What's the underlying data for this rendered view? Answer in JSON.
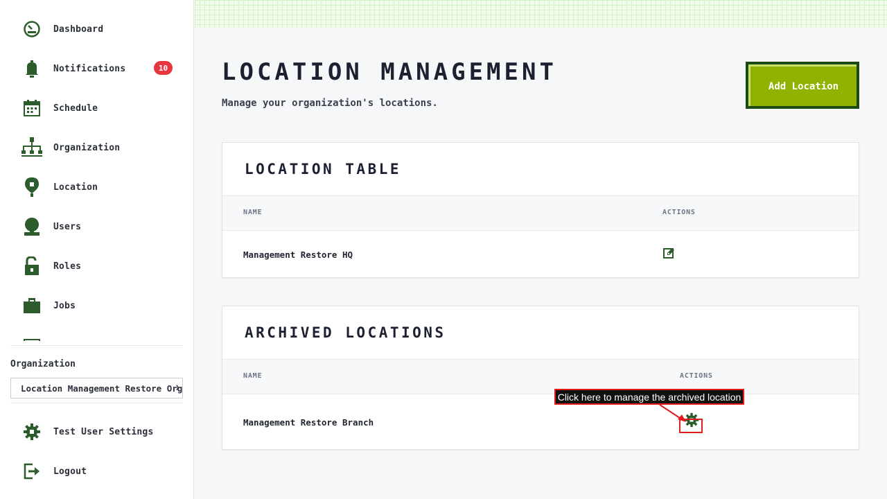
{
  "sidebar": {
    "items": [
      {
        "label": "Dashboard",
        "icon": "dashboard-icon"
      },
      {
        "label": "Notifications",
        "icon": "bell-icon",
        "badge": "10"
      },
      {
        "label": "Schedule",
        "icon": "calendar-icon"
      },
      {
        "label": "Organization",
        "icon": "org-chart-icon"
      },
      {
        "label": "Location",
        "icon": "map-pin-icon"
      },
      {
        "label": "Users",
        "icon": "user-icon"
      },
      {
        "label": "Roles",
        "icon": "lock-icon"
      },
      {
        "label": "Jobs",
        "icon": "briefcase-icon"
      }
    ],
    "org_label": "Organization",
    "org_selected": "Location Management Restore Org",
    "settings_label": "Test User Settings",
    "logout_label": "Logout"
  },
  "header": {
    "title": "Location Management",
    "subtitle": "Manage your organization's locations.",
    "add_button": "Add Location"
  },
  "location_table": {
    "title": "Location Table",
    "columns": [
      "Name",
      "Actions"
    ],
    "rows": [
      {
        "name": "Management Restore HQ"
      }
    ]
  },
  "archived_table": {
    "title": "Archived Locations",
    "columns": [
      "Name",
      "Actions"
    ],
    "rows": [
      {
        "name": "Management Restore Branch"
      }
    ]
  },
  "annotation": {
    "text": "Click here to manage the archived location"
  },
  "colors": {
    "accent": "#8fb300",
    "accent_dark": "#1c4a12",
    "icon": "#2c5b2c",
    "badge": "#e8363f",
    "annotation": "#e21b1b"
  }
}
